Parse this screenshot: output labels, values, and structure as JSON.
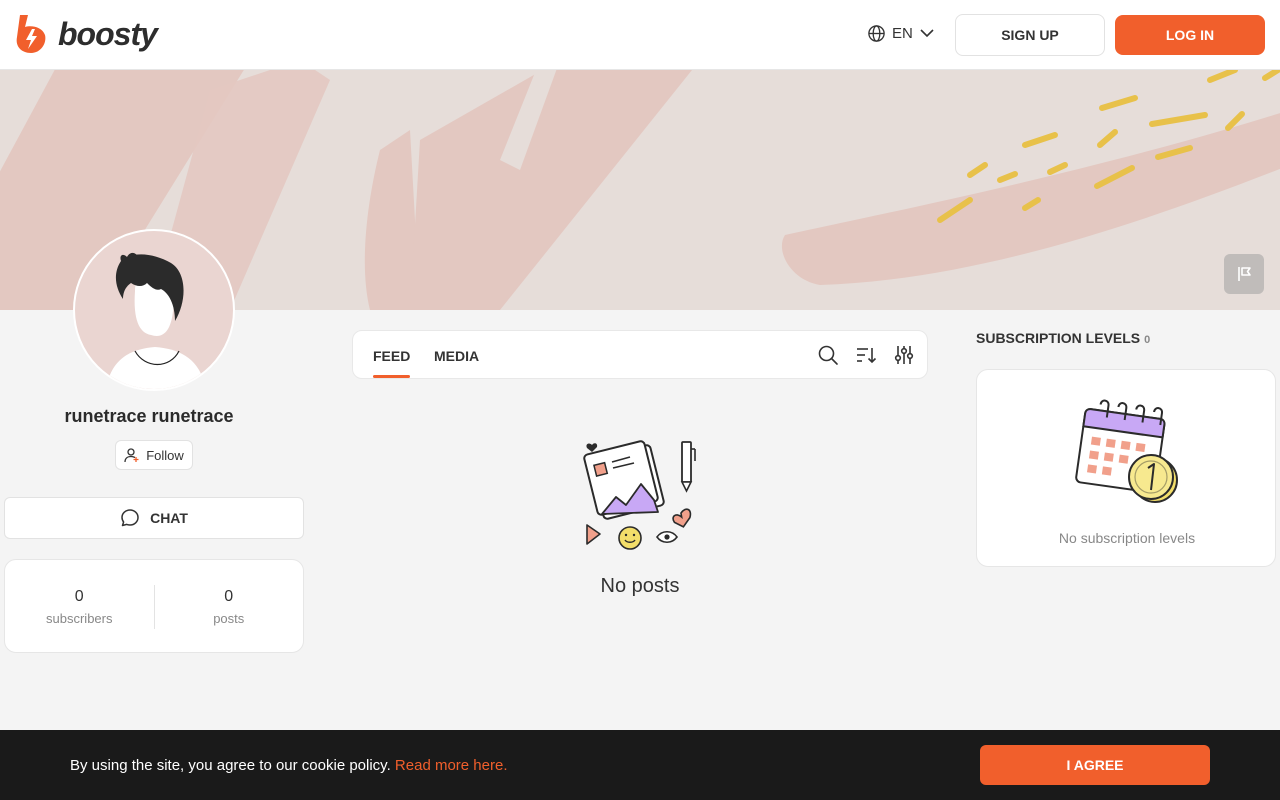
{
  "brand": {
    "name": "boosty",
    "accent": "#f15f2c"
  },
  "header": {
    "language": "EN",
    "signup_label": "SIGN UP",
    "login_label": "LOG IN"
  },
  "profile": {
    "name": "runetrace runetrace",
    "follow_label": "Follow",
    "chat_label": "CHAT",
    "stats": {
      "subscribers_value": "0",
      "subscribers_label": "subscribers",
      "posts_value": "0",
      "posts_label": "posts"
    }
  },
  "feed": {
    "tabs": [
      {
        "label": "FEED",
        "active": true
      },
      {
        "label": "MEDIA",
        "active": false
      }
    ],
    "tools": [
      "search-icon",
      "sort-icon",
      "filter-icon"
    ],
    "empty_text": "No posts"
  },
  "subscription": {
    "title": "SUBSCRIPTION LEVELS",
    "count": "0",
    "empty_text": "No subscription levels"
  },
  "cookie": {
    "text": "By using the site, you agree to our cookie policy.",
    "link_text": "Read more here.",
    "agree_label": "I AGREE"
  }
}
